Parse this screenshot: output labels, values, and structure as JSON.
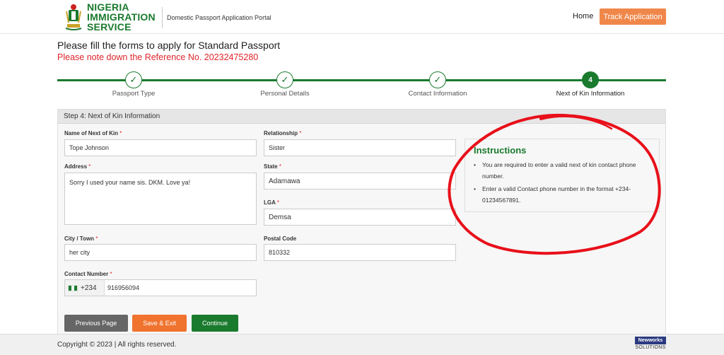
{
  "header": {
    "org_name_line1": "NIGERIA",
    "org_name_line2": "IMMIGRATION",
    "org_name_line3": "SERVICE",
    "portal_name": "Domestic Passport Application Portal",
    "nav_home": "Home",
    "track_button": "Track Application"
  },
  "page": {
    "title": "Please fill the forms to apply for Standard Passport",
    "reference_note": "Please note down the Reference No. 20232475280"
  },
  "stepper": {
    "steps": [
      {
        "label": "Passport Type",
        "marker": "✓",
        "state": "done"
      },
      {
        "label": "Personal Details",
        "marker": "✓",
        "state": "done"
      },
      {
        "label": "Contact Information",
        "marker": "✓",
        "state": "done"
      },
      {
        "label": "Next of Kin Information",
        "marker": "4",
        "state": "active"
      }
    ]
  },
  "form": {
    "heading": "Step 4: Next of Kin Information",
    "kin_name_label": "Name of Next of Kin",
    "kin_name_value": "Tope Johnson",
    "relationship_label": "Relationship",
    "relationship_value": "Sister",
    "address_label": "Address",
    "address_value": "Sorry I used your name sis. DKM. Love ya!",
    "state_label": "State",
    "state_value": "Adamawa",
    "lga_label": "LGA",
    "lga_value": "Demsa",
    "city_label": "City / Town",
    "city_value": "her city",
    "postal_label": "Postal Code",
    "postal_value": "810332",
    "contact_label": "Contact Number",
    "contact_prefix": "+234",
    "contact_value": "916956094",
    "required_marker": "*",
    "prev_button": "Previous Page",
    "save_button": "Save & Exit",
    "continue_button": "Continue"
  },
  "instructions": {
    "title": "Instructions",
    "items": [
      "You are required to enter a valid next of kin contact phone number.",
      "Enter a valid Contact phone number in the format +234-01234567891."
    ]
  },
  "footer": {
    "copyright": "Copyright © 2023 | All rights reserved.",
    "vendor_top": "Newworks",
    "vendor_bottom": "SOLUTIONS"
  },
  "colors": {
    "brand_green": "#1a7a2e",
    "accent_orange": "#f0874a",
    "alert_red": "#e0252b",
    "annotation_red": "#e8101a"
  }
}
